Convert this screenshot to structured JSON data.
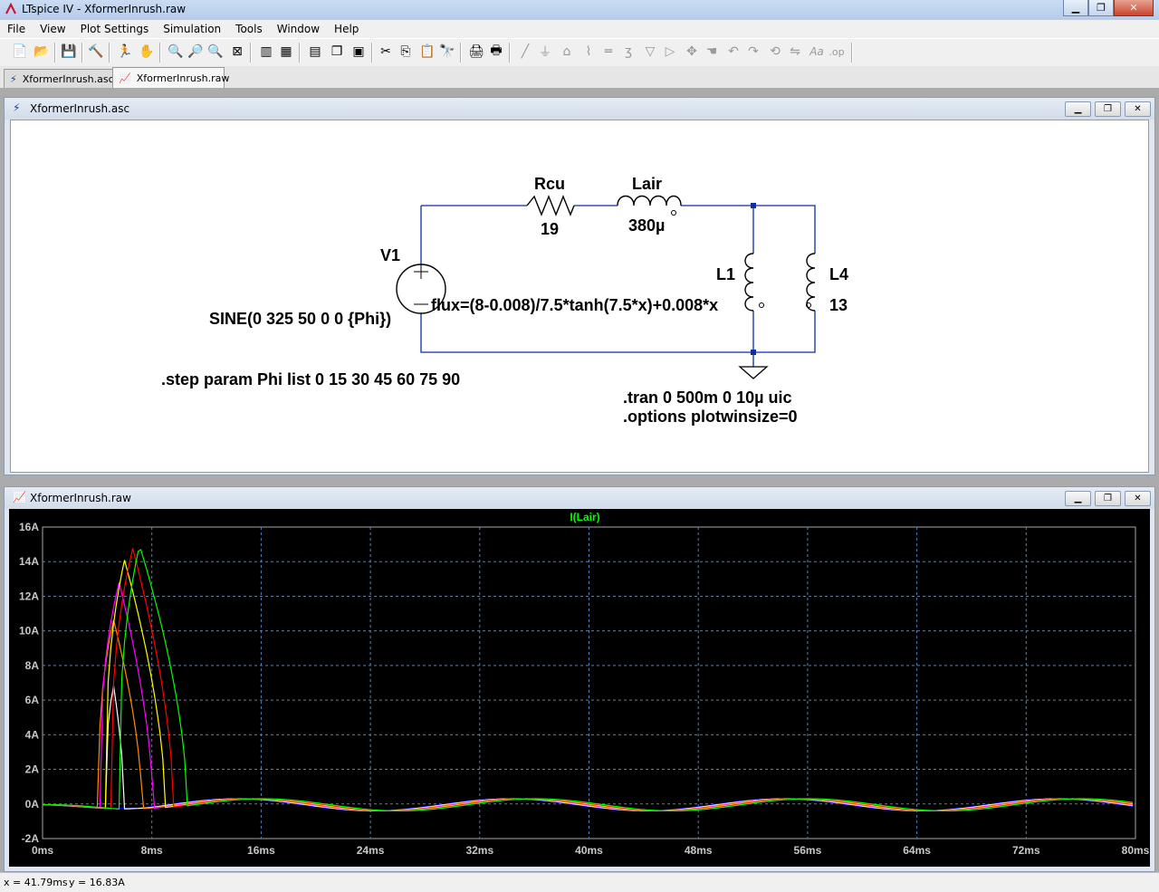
{
  "window": {
    "title": "LTspice IV - XformerInrush.raw"
  },
  "menu": [
    "File",
    "View",
    "Plot Settings",
    "Simulation",
    "Tools",
    "Window",
    "Help"
  ],
  "tabs": [
    {
      "label": "XformerInrush.asc",
      "icon": "schematic-icon"
    },
    {
      "label": "XformerInrush.raw",
      "icon": "waveform-icon"
    }
  ],
  "schematic": {
    "title": "XformerInrush.asc",
    "components": {
      "rcu": {
        "name": "Rcu",
        "value": "19"
      },
      "lair": {
        "name": "Lair",
        "value": "380µ"
      },
      "v1": {
        "name": "V1",
        "value": "SINE(0 325 50 0 0 {Phi})"
      },
      "l1": {
        "name": "L1",
        "value": "flux=(8-0.008)/7.5*tanh(7.5*x)+0.008*x"
      },
      "l4": {
        "name": "L4",
        "value": "13"
      }
    },
    "directives": {
      "step": ".step param Phi list 0 15 30 45 60 75 90",
      "tran": ".tran 0 500m 0 10µ uic",
      "options": ".options plotwinsize=0"
    }
  },
  "plot": {
    "title": "XformerInrush.raw",
    "trace_label": "I(Lair)"
  },
  "chart_data": {
    "type": "line",
    "title": "I(Lair)",
    "xlabel": "",
    "ylabel": "",
    "x_ticks": [
      "0ms",
      "8ms",
      "16ms",
      "24ms",
      "32ms",
      "40ms",
      "48ms",
      "56ms",
      "64ms",
      "72ms",
      "80ms"
    ],
    "y_ticks": [
      "-2A",
      "0A",
      "2A",
      "4A",
      "6A",
      "8A",
      "10A",
      "12A",
      "14A",
      "16A"
    ],
    "xlim": [
      0,
      80
    ],
    "ylim": [
      -2,
      16
    ],
    "x_unit": "ms",
    "y_unit": "A",
    "grid": true,
    "series": [
      {
        "color": "#0000ff",
        "peak_t": null,
        "peak": 0,
        "rise_t": null,
        "end_t": null
      },
      {
        "color": "#ffffff",
        "peak_t": 5.2,
        "peak": 7.1,
        "rise_t": 4.6,
        "end_t": 6.0
      },
      {
        "color": "#ff8c00",
        "peak_t": 5.2,
        "peak": 10.9,
        "rise_t": 4.1,
        "end_t": 7.3
      },
      {
        "color": "#ff00ff",
        "peak_t": 5.6,
        "peak": 13.1,
        "rise_t": 4.2,
        "end_t": 8.1
      },
      {
        "color": "#ffff00",
        "peak_t": 6.0,
        "peak": 14.4,
        "rise_t": 4.6,
        "end_t": 9.0
      },
      {
        "color": "#ff0000",
        "peak_t": 6.6,
        "peak": 15.1,
        "rise_t": 5.0,
        "end_t": 9.6
      },
      {
        "color": "#00ff00",
        "peak_t": 7.1,
        "peak": 15.3,
        "rise_t": 5.6,
        "end_t": 10.6
      }
    ]
  },
  "statusbar": {
    "x": "x = 41.79ms",
    "y": "y = 16.83A"
  }
}
